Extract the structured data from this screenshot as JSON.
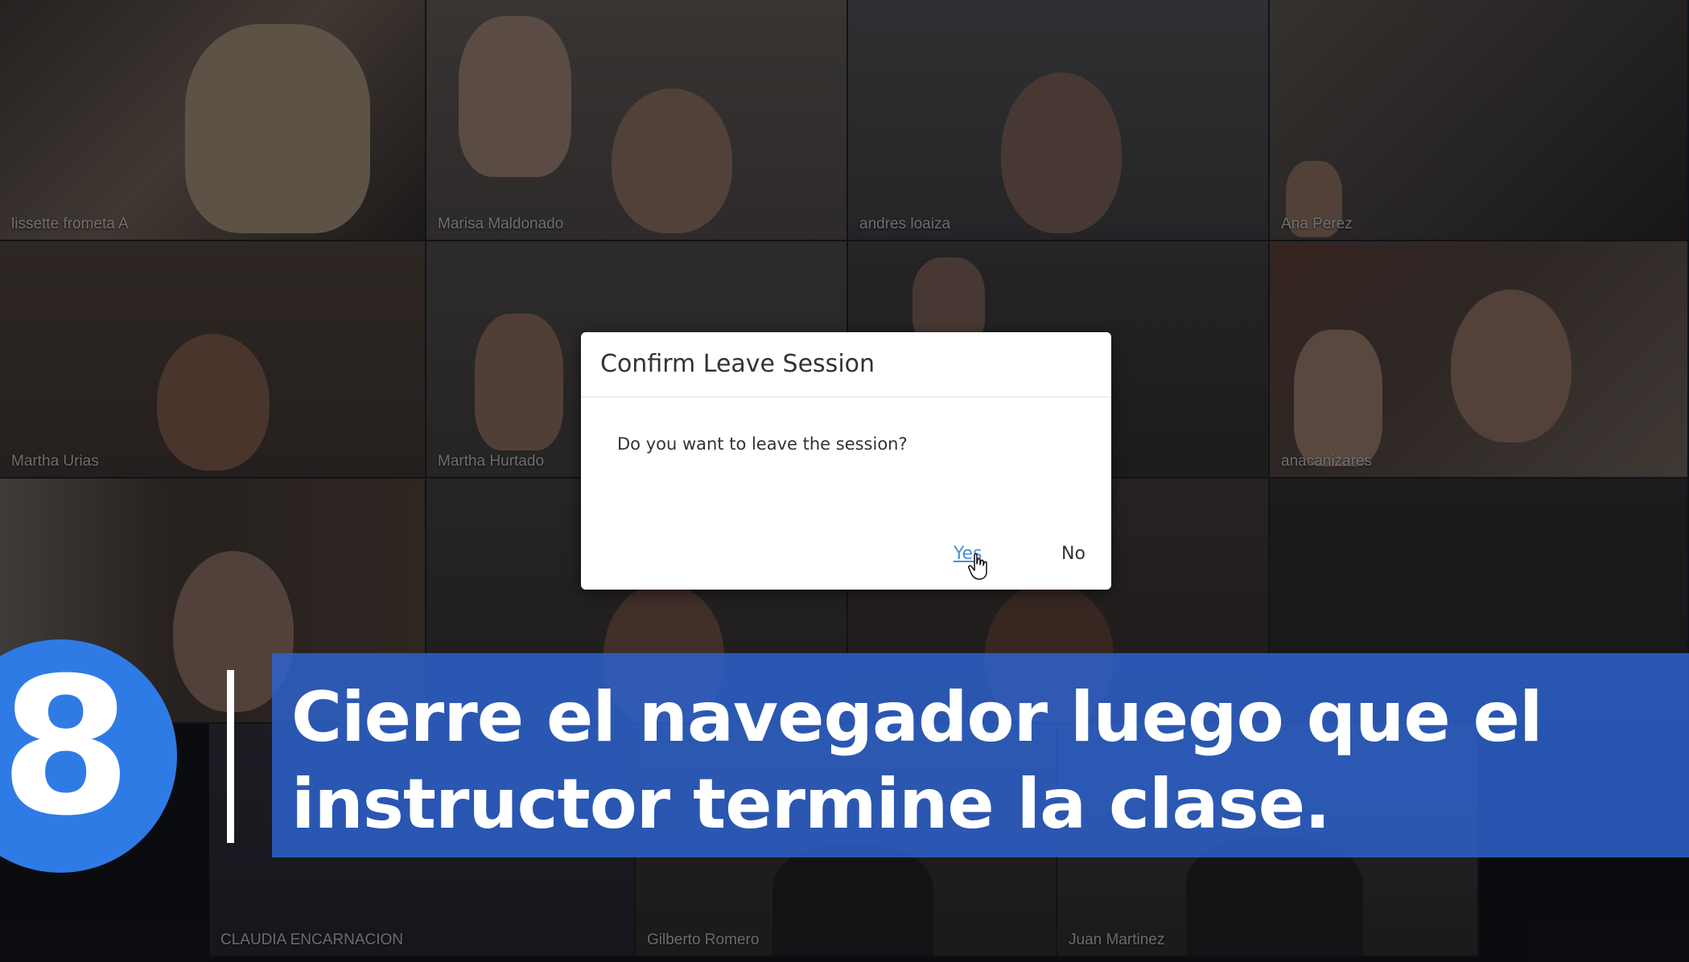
{
  "participants": [
    {
      "name": "lissette frometa A"
    },
    {
      "name": "Marisa Maldonado"
    },
    {
      "name": "andres loaiza"
    },
    {
      "name": "Ana Perez"
    },
    {
      "name": "Martha Urias"
    },
    {
      "name": "Martha Hurtado"
    },
    {
      "name": ""
    },
    {
      "name": "anacanizares"
    },
    {
      "name": ""
    },
    {
      "name": ""
    },
    {
      "name": ""
    },
    {
      "name": ""
    },
    {
      "name": "CLAUDIA ENCARNACION"
    },
    {
      "name": "Gilberto Romero"
    },
    {
      "name": "Juan Martinez"
    }
  ],
  "dialog": {
    "title": "Confirm Leave Session",
    "message": "Do you want to leave the session?",
    "yes_label": "Yes",
    "no_label": "No"
  },
  "step": {
    "number": "8",
    "caption_line1": "Cierre el navegador luego que el",
    "caption_line2": "instructor termine la clase."
  },
  "colors": {
    "step_circle": "#2f7be6",
    "banner": "#2d64d2",
    "yes_link": "#4a8fd4"
  }
}
